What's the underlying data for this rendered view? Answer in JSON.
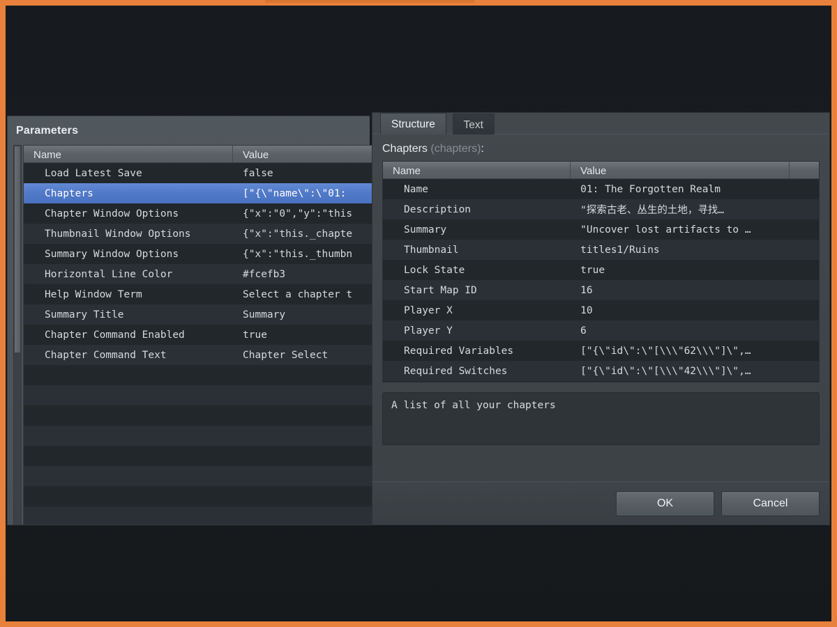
{
  "window": {
    "accent_color": "#e8813c",
    "backdrop_color": "#171b1f"
  },
  "parameters_panel": {
    "title": "Parameters",
    "columns": [
      "Name",
      "Value"
    ],
    "rows": [
      {
        "name": "Load Latest Save",
        "value": "false",
        "selected": false
      },
      {
        "name": "Chapters",
        "value": "[\"{\\\"name\\\":\\\"01:",
        "selected": true
      },
      {
        "name": "Chapter Window Options",
        "value": "{\"x\":\"0\",\"y\":\"this",
        "selected": false
      },
      {
        "name": "Thumbnail Window Options",
        "value": "{\"x\":\"this._chapte",
        "selected": false
      },
      {
        "name": "Summary Window Options",
        "value": "{\"x\":\"this._thumbn",
        "selected": false
      },
      {
        "name": "Horizontal Line Color",
        "value": "#fcefb3",
        "selected": false
      },
      {
        "name": "Help Window Term",
        "value": "Select a chapter t",
        "selected": false
      },
      {
        "name": "Summary Title",
        "value": "Summary",
        "selected": false
      },
      {
        "name": "Chapter Command Enabled",
        "value": "true",
        "selected": false
      },
      {
        "name": "Chapter Command Text",
        "value": "Chapter Select",
        "selected": false
      },
      {
        "name": "",
        "value": "",
        "selected": false
      },
      {
        "name": "",
        "value": "",
        "selected": false
      },
      {
        "name": "",
        "value": "",
        "selected": false
      },
      {
        "name": "",
        "value": "",
        "selected": false
      },
      {
        "name": "",
        "value": "",
        "selected": false
      },
      {
        "name": "",
        "value": "",
        "selected": false
      },
      {
        "name": "",
        "value": "",
        "selected": false
      },
      {
        "name": "",
        "value": "",
        "selected": false
      }
    ]
  },
  "dialog": {
    "tabs": [
      {
        "label": "Structure",
        "active": true
      },
      {
        "label": "Text",
        "active": false
      }
    ],
    "field_label": "Chapters",
    "field_key": "(chapters)",
    "field_label_suffix": ":",
    "columns": [
      "Name",
      "Value"
    ],
    "rows": [
      {
        "name": "Name",
        "value": "01: The Forgotten Realm"
      },
      {
        "name": "Description",
        "value": "\"探索古老、丛生的土地，寻找…"
      },
      {
        "name": "Summary",
        "value": "\"Uncover lost artifacts to …"
      },
      {
        "name": "Thumbnail",
        "value": "titles1/Ruins"
      },
      {
        "name": "Lock State",
        "value": "true"
      },
      {
        "name": "Start Map ID",
        "value": "16"
      },
      {
        "name": "Player X",
        "value": "10"
      },
      {
        "name": "Player Y",
        "value": "6"
      },
      {
        "name": "Required Variables",
        "value": "[\"{\\\"id\\\":\\\"[\\\\\\\"62\\\\\\\"]\\\",…"
      },
      {
        "name": "Required Switches",
        "value": "[\"{\\\"id\\\":\\\"[\\\\\\\"42\\\\\\\"]\\\",…"
      },
      {
        "name": "",
        "value": ""
      },
      {
        "name": "",
        "value": ""
      }
    ],
    "help_text": "A list of all your chapters",
    "ok_label": "OK",
    "cancel_label": "Cancel"
  }
}
